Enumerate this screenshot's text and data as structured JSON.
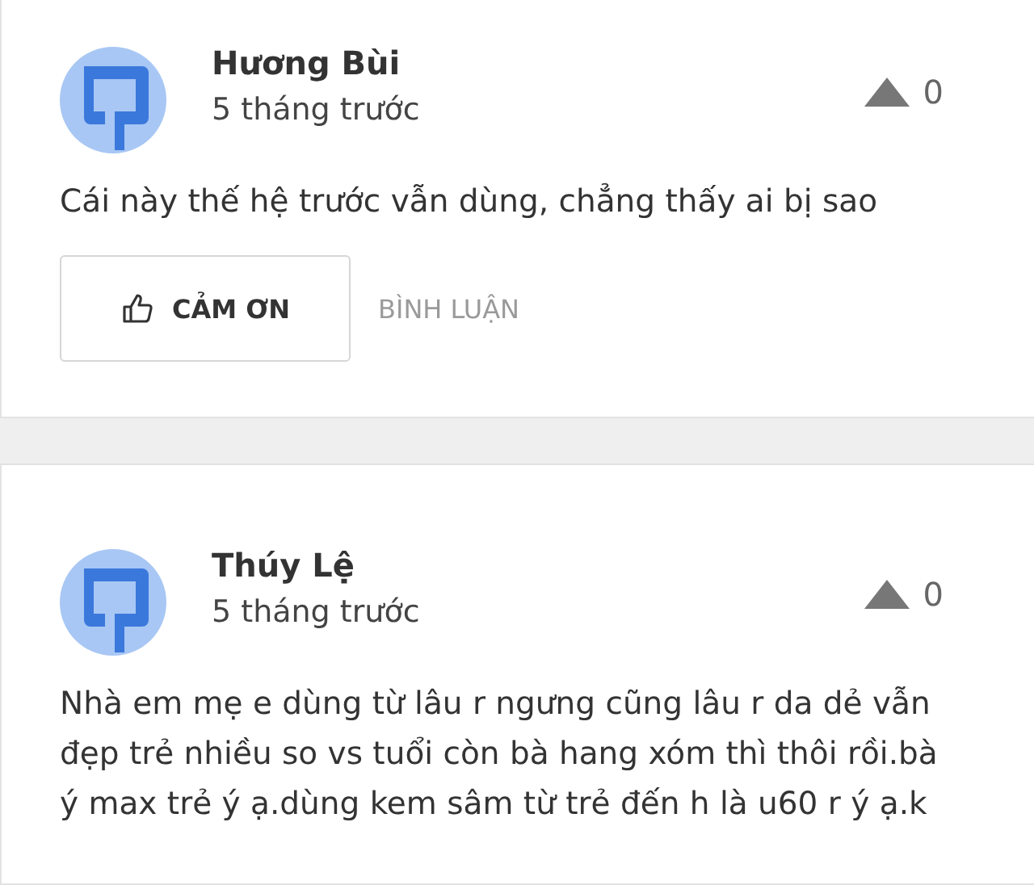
{
  "comments": [
    {
      "author": "Hương Bùi",
      "time": "5 tháng trước",
      "votes": "0",
      "text": "Cái này thế hệ trước vẫn dùng, chẳng thấy ai bị sao",
      "actions": {
        "thanks": "CẢM ƠN",
        "reply": "BÌNH LUẬN"
      }
    },
    {
      "author": "Thúy Lệ",
      "time": "5 tháng trước",
      "votes": "0",
      "text": "Nhà em mẹ e dùng từ lâu r ngưng cũng lâu r da dẻ vẫn\nđẹp trẻ nhiều so vs tuổi còn bà hang xóm thì thôi rồi.bà\ný max trẻ ý ạ.dùng kem sâm từ trẻ đến h là u60 r ý ạ.k"
    }
  ]
}
